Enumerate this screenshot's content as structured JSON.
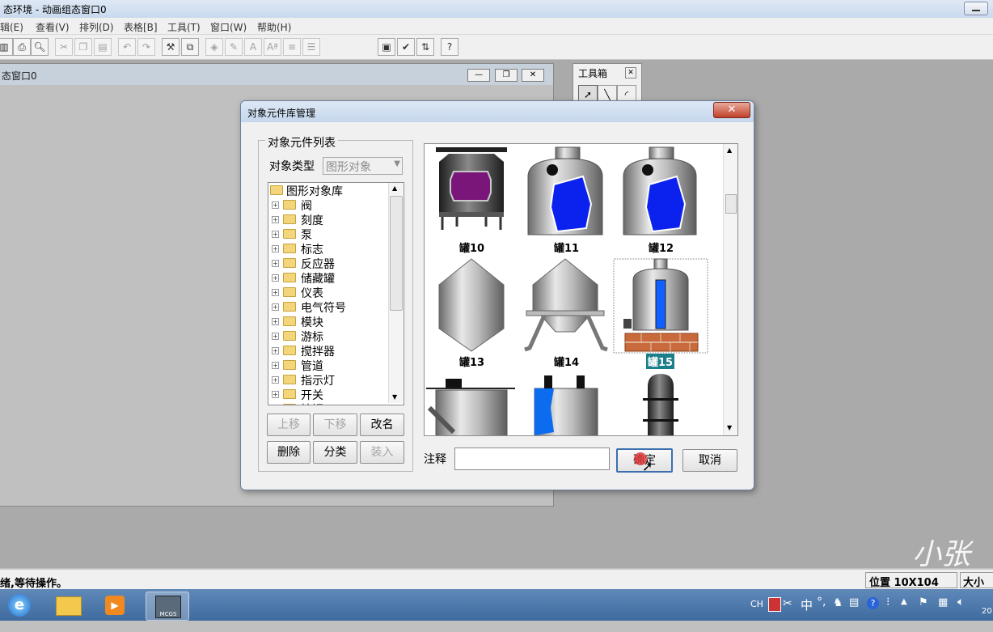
{
  "window": {
    "title": "态环境 - 动画组态窗口0"
  },
  "menu": [
    "辑(E)",
    "查看(V)",
    "排列(D)",
    "表格[B]",
    "工具(T)",
    "窗口(W)",
    "帮助(H)"
  ],
  "child_window": {
    "title": "态窗口0"
  },
  "toolbox": {
    "title": "工具箱"
  },
  "dialog": {
    "title": "对象元件库管理",
    "close_glyph": "✕",
    "group_label": "对象元件列表",
    "object_type_label": "对象类型",
    "object_type_value": "图形对象",
    "tree": {
      "root": "图形对象库",
      "items": [
        "阀",
        "刻度",
        "泵",
        "标志",
        "反应器",
        "储藏罐",
        "仪表",
        "电气符号",
        "模块",
        "游标",
        "搅拌器",
        "管道",
        "指示灯",
        "开关",
        "按钮"
      ]
    },
    "buttons": {
      "move_up": "上移",
      "move_down": "下移",
      "rename": "改名",
      "delete": "删除",
      "classify": "分类",
      "load": "装入"
    },
    "gallery": {
      "items": [
        "罐10",
        "罐11",
        "罐12",
        "罐13",
        "罐14",
        "罐15"
      ],
      "selected": "罐15"
    },
    "note_label": "注释",
    "note_value": "",
    "ok_label": "确定",
    "cancel_label": "取消"
  },
  "status": {
    "message": "绪,等待操作。",
    "position": "位置 10X104",
    "size": "大小"
  },
  "tray": {
    "lang": "CH",
    "ime": "中",
    "time": "20"
  },
  "watermark": "小张老"
}
